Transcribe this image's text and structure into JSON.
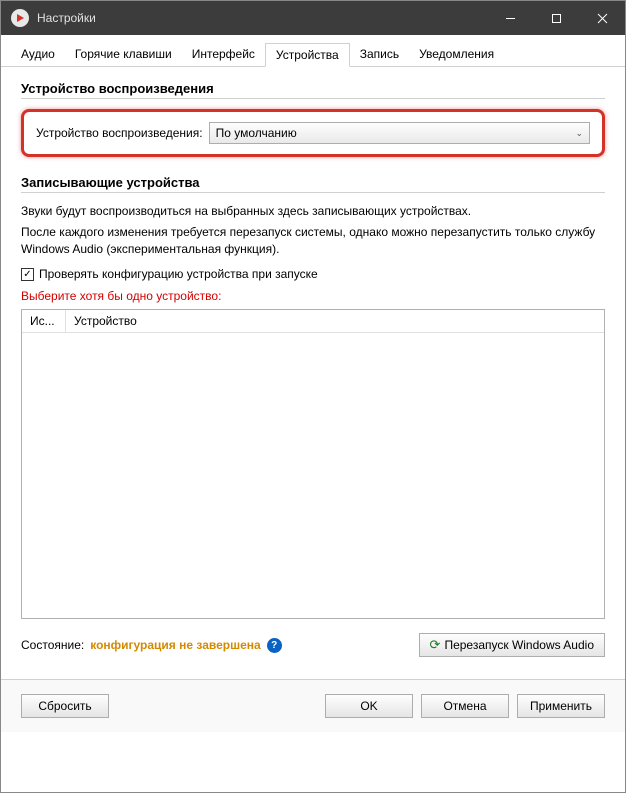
{
  "titlebar": {
    "title": "Настройки"
  },
  "tabs": {
    "audio": "Аудио",
    "hotkeys": "Горячие клавиши",
    "interface": "Интерфейс",
    "devices": "Устройства",
    "record": "Запись",
    "notifications": "Уведомления"
  },
  "playback": {
    "group_title": "Устройство воспроизведения",
    "label": "Устройство воспроизведения:",
    "value": "По умолчанию"
  },
  "recording": {
    "group_title": "Записывающие устройства",
    "desc1": "Звуки будут воспроизводиться на выбранных здесь записывающих устройствах.",
    "desc2": "После каждого изменения требуется перезапуск системы, однако можно перезапустить только службу Windows Audio (экспериментальная функция).",
    "checkbox_label": "Проверять конфигурацию устройства при запуске",
    "warning": "Выберите хотя бы одно устройство:",
    "col_use": "Ис...",
    "col_device": "Устройство",
    "status_label": "Состояние:",
    "status_value": "конфигурация не завершена",
    "restart_button": "Перезапуск Windows Audio"
  },
  "footer": {
    "reset": "Сбросить",
    "ok": "OK",
    "cancel": "Отмена",
    "apply": "Применить"
  }
}
